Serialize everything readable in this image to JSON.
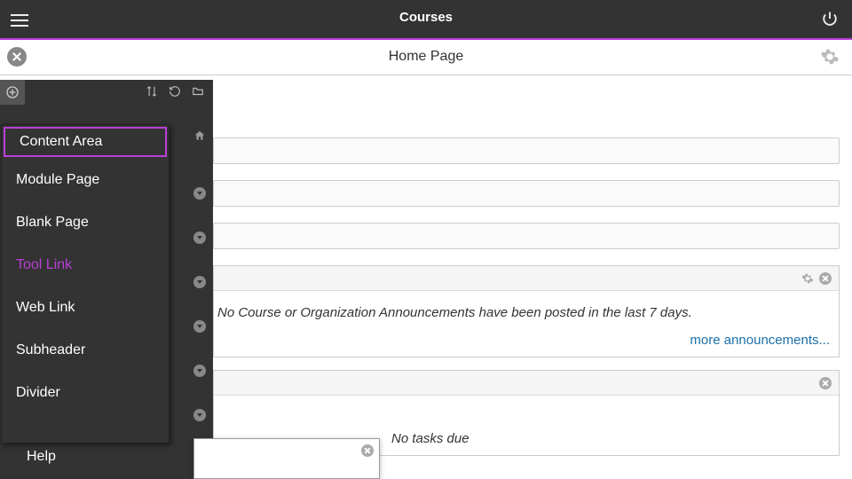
{
  "topbar": {
    "title": "Courses"
  },
  "pagehdr": {
    "title": "Home Page"
  },
  "menu": {
    "items": [
      {
        "label": "Content Area",
        "selected": true
      },
      {
        "label": "Module Page"
      },
      {
        "label": "Blank Page"
      },
      {
        "label": "Tool Link",
        "link": true
      },
      {
        "label": "Web Link"
      },
      {
        "label": "Subheader"
      },
      {
        "label": "Divider"
      }
    ]
  },
  "sidebar": {
    "help_label": "Help"
  },
  "announcements": {
    "empty_text": "No Course or Organization Announcements have been posted in the last 7 days.",
    "more_label": "more announcements..."
  },
  "tasks": {
    "empty_text": "No tasks due"
  }
}
